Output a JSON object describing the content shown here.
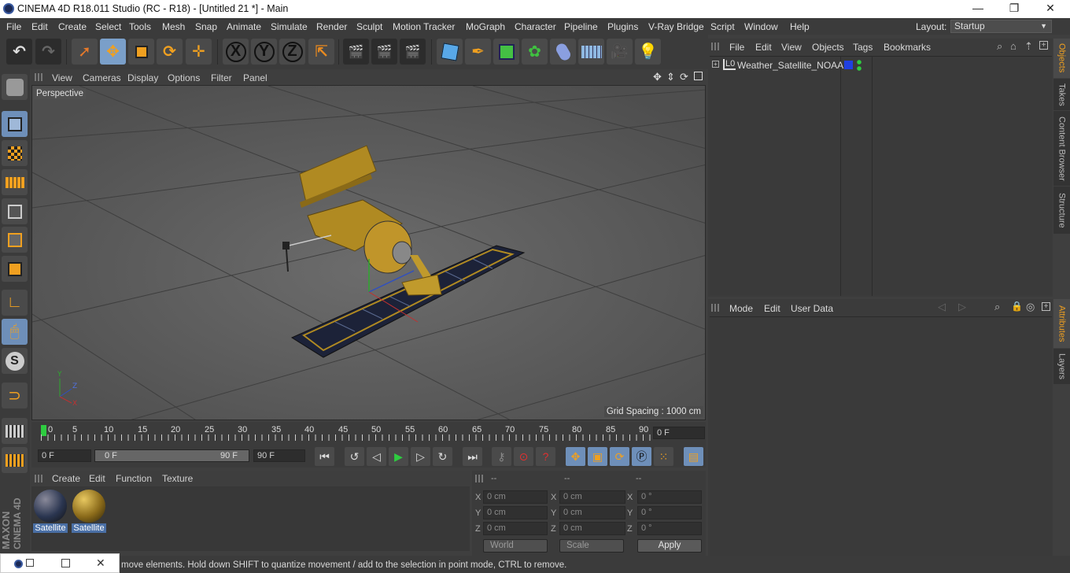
{
  "window": {
    "title": "CINEMA 4D R18.011 Studio (RC - R18) - [Untitled 21 *] - Main",
    "minimize": "—",
    "restore": "❐",
    "close": "✕"
  },
  "menubar": {
    "items": [
      "File",
      "Edit",
      "Create",
      "Select",
      "Tools",
      "Mesh",
      "Snap",
      "Animate",
      "Simulate",
      "Render",
      "Sculpt",
      "Motion Tracker",
      "MoGraph",
      "Character",
      "Pipeline",
      "Plugins",
      "V-Ray Bridge",
      "Script",
      "Window",
      "Help"
    ],
    "layout_label": "Layout:",
    "layout_value": "Startup"
  },
  "toolbar": {
    "axis_x": "X",
    "axis_y": "Y",
    "axis_z": "Z"
  },
  "viewport": {
    "menu": [
      "View",
      "Cameras",
      "Display",
      "Options",
      "Filter",
      "Panel"
    ],
    "label": "Perspective",
    "grid_spacing": "Grid Spacing : 1000 cm"
  },
  "timeline": {
    "ticks": [
      "0",
      "5",
      "10",
      "15",
      "20",
      "25",
      "30",
      "35",
      "40",
      "45",
      "50",
      "55",
      "60",
      "65",
      "70",
      "75",
      "80",
      "85",
      "90"
    ],
    "current_frame": "0 F"
  },
  "transport": {
    "start_field": "0 F",
    "range_start": "0 F",
    "range_end": "90 F",
    "end_field": "90 F"
  },
  "materials": {
    "menu": [
      "Create",
      "Edit",
      "Function",
      "Texture"
    ],
    "items": [
      {
        "name": "Satellite",
        "color": "#2a3550"
      },
      {
        "name": "Satellite",
        "color": "#8a6a1a"
      }
    ]
  },
  "coordinates": {
    "col_headers": [
      "--",
      "--",
      "--"
    ],
    "rows": [
      {
        "a": "X",
        "va": "0 cm",
        "b": "X",
        "vb": "0 cm",
        "c": "X",
        "vc": "0 °"
      },
      {
        "a": "Y",
        "va": "0 cm",
        "b": "Y",
        "vb": "0 cm",
        "c": "Y",
        "vc": "0 °"
      },
      {
        "a": "Z",
        "va": "0 cm",
        "b": "Z",
        "vb": "0 cm",
        "c": "Z",
        "vc": "0 °"
      }
    ],
    "mode": "World",
    "scale": "Scale",
    "apply": "Apply"
  },
  "objects": {
    "menu": [
      "File",
      "Edit",
      "View",
      "Objects",
      "Tags",
      "Bookmarks"
    ],
    "item": "Weather_Satellite_NOAA",
    "layer_icon": "L0"
  },
  "attributes": {
    "menu": [
      "Mode",
      "Edit",
      "User Data"
    ]
  },
  "side_tabs": {
    "top": [
      "Objects",
      "Takes",
      "Content Browser",
      "Structure"
    ],
    "bottom": [
      "Attributes",
      "Layers"
    ]
  },
  "branding": {
    "maxon": "MAXON",
    "c4d": "CINEMA 4D"
  },
  "status": {
    "text": "move elements. Hold down SHIFT to quantize movement / add to the selection in point mode, CTRL to remove."
  },
  "colors": {
    "accent_blue": "#7a9fc9",
    "satellite_gold": "#b08a22",
    "panel_navy": "#1c2238"
  }
}
